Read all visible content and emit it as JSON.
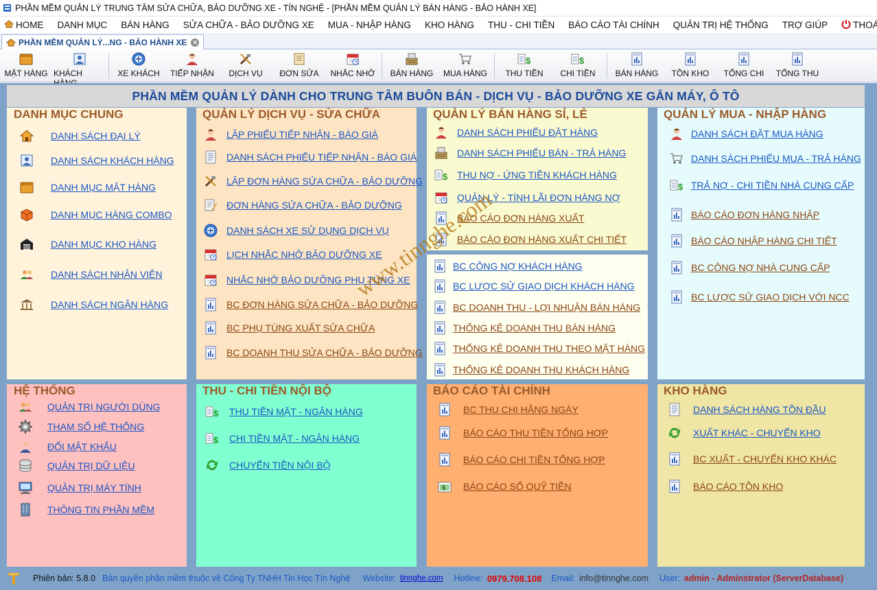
{
  "window": {
    "title": "PHẦN MỀM QUẢN LÝ TRUNG TÂM  SỬA CHỮA, BẢO DƯỠNG XE - TÍN NGHỆ - [PHẦN MỀM QUẢN LÝ BÁN HÀNG - BẢO HÀNH XE]"
  },
  "menu": [
    {
      "label": "HOME",
      "icon": "home-icon"
    },
    {
      "label": "DANH MỤC"
    },
    {
      "label": "BÁN HÀNG"
    },
    {
      "label": "SỬA CHỮA - BẢO DƯỠNG XE"
    },
    {
      "label": "MUA - NHẬP HÀNG"
    },
    {
      "label": "KHO HÀNG"
    },
    {
      "label": "THU - CHI TIỀN"
    },
    {
      "label": "BÁO CÁO TÀI CHÍNH"
    },
    {
      "label": "QUẢN TRỊ HỆ THỐNG"
    },
    {
      "label": "TRỢ GIÚP"
    },
    {
      "label": "THOÁT",
      "icon": "power-icon"
    }
  ],
  "tab": {
    "label": "PHẦN MỀM QUẢN LÝ...NG - BẢO HÀNH XE"
  },
  "toolbar": [
    {
      "label": "MẶT HÀNG",
      "icon": "box-icon"
    },
    {
      "label": "KHÁCH HÀNG",
      "icon": "customer-icon"
    },
    {
      "label": "XE KHÁCH",
      "icon": "vehicle-icon"
    },
    {
      "label": "TIẾP NHẬN",
      "icon": "reception-icon"
    },
    {
      "label": "DỊCH VỤ",
      "icon": "tools-icon"
    },
    {
      "label": "ĐƠN SỬA",
      "icon": "repair-order-icon"
    },
    {
      "label": "NHẮC NHỞ",
      "icon": "calendar-icon"
    },
    {
      "label": "BÁN HÀNG",
      "icon": "cash-register-icon"
    },
    {
      "label": "MUA HÀNG",
      "icon": "cart-icon"
    },
    {
      "label": "THU TIỀN",
      "icon": "money-in-icon"
    },
    {
      "label": "CHI TIỀN",
      "icon": "money-out-icon"
    },
    {
      "label": "BÁN HÀNG",
      "icon": "report-icon"
    },
    {
      "label": "TỒN KHO",
      "icon": "report-icon"
    },
    {
      "label": "TỔNG CHI",
      "icon": "report-icon"
    },
    {
      "label": "TỔNG THU",
      "icon": "report-icon"
    }
  ],
  "banner": "PHẦN MỀM QUẢN LÝ DÀNH CHO TRUNG TÂM BUÔN BÁN - DỊCH VỤ - BẢO DƯỠNG XE GẮN MÁY, Ô TÔ",
  "panels": {
    "danh_muc_chung": {
      "title": "DANH MỤC CHUNG",
      "links": [
        {
          "label": "DANH SÁCH ĐẠI LÝ",
          "icon": "home-icon"
        },
        {
          "label": "DANH SÁCH KHÁCH HÀNG",
          "icon": "customer-icon"
        },
        {
          "label": "DANH MỤC MẶT HÀNG",
          "icon": "box-icon"
        },
        {
          "label": "DANH MỤC HÀNG COMBO",
          "icon": "combo-box-icon"
        },
        {
          "label": "DANH MỤC KHO HÀNG",
          "icon": "warehouse-icon"
        },
        {
          "label": "DANH SÁCH NHÂN VIÊN",
          "icon": "staff-icon"
        },
        {
          "label": "DANH SÁCH NGÂN HÀNG",
          "icon": "bank-icon"
        }
      ]
    },
    "dich_vu": {
      "title": "QUẢN LÝ DỊCH VỤ -  SỬA CHỮA",
      "links": [
        {
          "label": "LẬP PHIẾU TIẾP NHẬN - BÁO GIÁ",
          "icon": "reception-icon"
        },
        {
          "label": "DANH SÁCH PHIẾU TIẾP NHẬN - BÁO GIÁ",
          "icon": "document-list-icon"
        },
        {
          "label": "LẬP ĐƠN HÀNG SỬA CHỮA - BẢO DƯỠNG",
          "icon": "tools-icon"
        },
        {
          "label": "ĐƠN HÀNG SỬA CHỮA - BẢO DƯỠNG",
          "icon": "edit-document-icon"
        },
        {
          "label": "DANH SÁCH XE SỬ DỤNG DỊCH VỤ",
          "icon": "vehicle-icon"
        },
        {
          "label": "LỊCH NHẮC NHỞ BẢO DƯỠNG XE",
          "icon": "calendar-icon"
        },
        {
          "label": "NHẮC NHỞ BẢO DƯỠNG PHỤ TÙNG XE",
          "icon": "calendar-icon"
        },
        {
          "label": "BC ĐƠN HÀNG SỬA CHỮA - BẢO DƯỠNG",
          "icon": "report-icon"
        },
        {
          "label": "BC PHỤ TÙNG XUẤT SỬA CHỮA",
          "icon": "report-icon"
        },
        {
          "label": "BC DOANH THU SỬA CHỮA - BẢO DƯỠNG",
          "icon": "report-icon"
        }
      ]
    },
    "ban_hang": {
      "title": "QUẢN LÝ BÁN HÀNG SỈ, LẺ",
      "links": [
        {
          "label": "DANH SÁCH PHIẾU ĐẶT HÀNG",
          "icon": "reception-icon"
        },
        {
          "label": "DANH SÁCH PHIẾU BÁN - TRẢ HÀNG",
          "icon": "cash-register-icon"
        },
        {
          "label": "THU NỢ - ỨNG TIỀN KHÁCH HÀNG",
          "icon": "money-in-icon"
        },
        {
          "label": "QUẢN LÝ - TÍNH LÃI ĐƠN HÀNG NỢ",
          "icon": "calendar-icon"
        },
        {
          "label": "BÁO CÁO ĐƠN HÀNG XUẤT",
          "icon": "report-icon"
        },
        {
          "label": "BÁO CÁO ĐƠN HÀNG XUẤT CHI TIẾT",
          "icon": "report-icon"
        }
      ],
      "links2": [
        {
          "label": "BC CÔNG NỢ KHÁCH HÀNG",
          "icon": "report-icon"
        },
        {
          "label": "BC LƯỢC SỬ GIAO DỊCH KHÁCH HÀNG",
          "icon": "report-icon"
        },
        {
          "label": "BC DOANH THU - LỢI NHUẬN BÁN HÀNG",
          "icon": "report-icon"
        },
        {
          "label": "THỐNG KÊ DOANH THU BÁN HÀNG",
          "icon": "report-icon"
        },
        {
          "label": "THỐNG KÊ DOANH THU THEO MẶT HÀNG",
          "icon": "report-icon"
        },
        {
          "label": "THỐNG KÊ DOANH THU KHÁCH HÀNG",
          "icon": "report-icon"
        }
      ]
    },
    "mua_hang": {
      "title": "QUẢN LÝ MUA - NHẬP HÀNG",
      "links": [
        {
          "label": "DANH SÁCH ĐẶT MUA HÀNG",
          "icon": "reception-icon"
        },
        {
          "label": "DANH SÁCH PHIẾU MUA - TRẢ HÀNG",
          "icon": "cart-icon"
        },
        {
          "label": "TRẢ NỢ - CHI TIỀN NHÀ CUNG CẤP",
          "icon": "money-out-icon"
        },
        {
          "label": "BÁO CÁO ĐƠN HÀNG NHẬP",
          "icon": "report-icon"
        },
        {
          "label": "BÁO CÁO NHẬP HÀNG CHI TIẾT",
          "icon": "report-icon"
        },
        {
          "label": "BC CÔNG NỢ NHÀ CUNG CẤP",
          "icon": "report-icon"
        },
        {
          "label": "BC LƯỢC SỬ GIAO DỊCH VỚI NCC",
          "icon": "report-icon"
        }
      ]
    },
    "he_thong": {
      "title": "HỆ THỐNG",
      "links": [
        {
          "label": "QUẢN TRỊ NGƯỜI DÙNG",
          "icon": "staff-icon"
        },
        {
          "label": "THAM SỐ HỆ THỐNG",
          "icon": "gear-icon"
        },
        {
          "label": "ĐỔI MẬT KHẨU",
          "icon": "user-icon"
        },
        {
          "label": "QUẢN TRỊ DỮ LIỆU",
          "icon": "database-icon"
        },
        {
          "label": "QUẢN TRỊ MÁY TÍNH",
          "icon": "computer-icon"
        },
        {
          "label": "THÔNG TIN PHẦN MỀM",
          "icon": "building-icon"
        }
      ]
    },
    "thu_chi": {
      "title": "THU - CHI TIỀN NỘI BỘ",
      "links": [
        {
          "label": "THU TIỀN MẶT - NGÂN HÀNG",
          "icon": "money-in-icon"
        },
        {
          "label": "CHI TIỀN MẶT - NGÂN HÀNG",
          "icon": "money-out-icon"
        },
        {
          "label": "CHUYỂN TIỀN NỘI BỘ",
          "icon": "transfer-icon"
        }
      ]
    },
    "bao_cao": {
      "title": "BÁO CÁO TÀI CHÍNH",
      "links": [
        {
          "label": "BC THU CHI HẰNG NGÀY",
          "icon": "report-icon"
        },
        {
          "label": "BÁO CÁO THU TIỀN TỔNG HỢP",
          "icon": "report-icon"
        },
        {
          "label": "BÁO CÁO CHI TIỀN TỔNG HỢP",
          "icon": "report-icon"
        },
        {
          "label": "BÁO CÁO SỔ QUỸ TIỀN",
          "icon": "cashbook-icon"
        }
      ]
    },
    "kho_hang": {
      "title": "KHO HÀNG",
      "links": [
        {
          "label": "DANH SÁCH HÀNG TỒN ĐẦU",
          "icon": "document-list-icon"
        },
        {
          "label": "XUẤT KHÁC - CHUYỂN KHO",
          "icon": "transfer-icon"
        },
        {
          "label": "BC XUẤT - CHUYỂN KHO KHÁC",
          "icon": "report-icon"
        },
        {
          "label": "BÁO CÁO TỒN KHO",
          "icon": "report-icon"
        }
      ]
    }
  },
  "watermark": "www.tinnghe.com",
  "status": {
    "version": "Phiên bản: 5.8.0",
    "copyright": "Bản quyền phần mềm thuộc về Công Ty TNHH Tin Học Tín Nghệ",
    "website_label": "Website:",
    "website": "tinnghe.com",
    "hotline_label": "Hotline:",
    "hotline": "0979.708.108",
    "email_label": "Email:",
    "email": "info@tinnghe.com",
    "user_label": "User:",
    "user": "admin - Adminstrator (ServerDatabase)"
  },
  "colors": {
    "panel_danh_muc": "#fff3dc",
    "panel_dich_vu": "#fde5c4",
    "panel_ban_hang": "#fafad0",
    "panel_ban_hang2": "#fffff0",
    "panel_mua_hang": "#e6fcfc",
    "panel_he_thong": "#ffc0c0",
    "panel_thu_chi": "#80ffd0",
    "panel_bao_cao": "#ffb070",
    "panel_kho_hang": "#efe6a6",
    "link_blue": "#1a56c4",
    "link_brown": "#8b4513",
    "hotline": "#e00000",
    "user": "#b22222"
  }
}
